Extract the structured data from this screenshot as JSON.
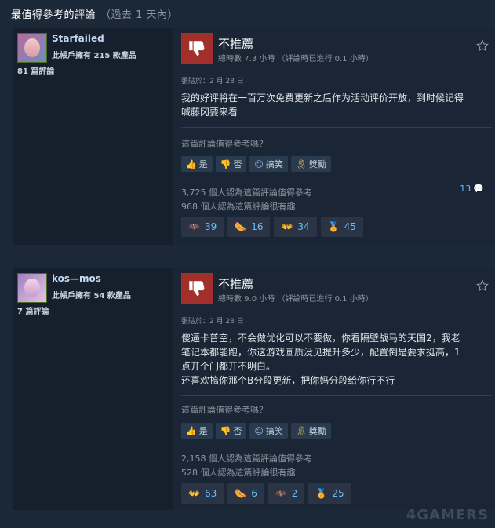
{
  "header": {
    "title": "最值得參考的評論",
    "subtitle": "（過去 1 天內）"
  },
  "reviews": [
    {
      "persona": "Starfailed",
      "products_owned": "此帳戶擁有 215 款產品",
      "review_count": "81 篇評論",
      "verdict": "不推薦",
      "hours": "總時數 7.3 小時 （評論時已進行 0.1 小時）",
      "posted": "張貼於：2 月 28 日",
      "content": [
        "我的好评将在一百万次免费更新之后作为活动评价开放，到时候记得",
        "喊藤冈要来看"
      ],
      "helpful_q": "這篇評論值得參考嗎？",
      "buttons": {
        "yes": "是",
        "no": "否",
        "funny": "搞笑",
        "award": "獎勵"
      },
      "helpful_stat": "3,725 個人認為這篇評論值得參考",
      "funny_stat": "968 個人認為這篇評論很有趣",
      "comment_count": "13",
      "awards": [
        {
          "icon": "bat-wings-icon",
          "count": "39",
          "color": "#e8e8e8"
        },
        {
          "icon": "hotdog-icon",
          "count": "16",
          "color": "#e8922e"
        },
        {
          "icon": "purple-hands-icon",
          "count": "34",
          "color": "#b86ce0"
        },
        {
          "icon": "medal-icon",
          "count": "45",
          "color": "#66c0f4"
        }
      ]
    },
    {
      "persona": "kos—mos",
      "products_owned": "此帳戶擁有 54 款產品",
      "review_count": "7 篇評論",
      "verdict": "不推薦",
      "hours": "總時數 9.0 小時 （評論時已進行 0.1 小時）",
      "posted": "張貼於：2 月 28 日",
      "content": [
        "傻逼卡普空，不会做优化可以不要做，你看隔壁战马的天国2，我老",
        "笔记本都能跑，你这游戏画质没见提升多少，配置倒是要求挺高，1",
        "点开个门都开不明白。",
        "还喜欢搞你那个B分段更新，把你妈分段给你行不行"
      ],
      "helpful_q": "這篇評論值得參考嗎？",
      "buttons": {
        "yes": "是",
        "no": "否",
        "funny": "搞笑",
        "award": "獎勵"
      },
      "helpful_stat": "2,158 個人認為這篇評論值得參考",
      "funny_stat": "528 個人認為這篇評論很有趣",
      "awards": [
        {
          "icon": "purple-hands-icon",
          "count": "63",
          "color": "#b86ce0"
        },
        {
          "icon": "hotdog-icon",
          "count": "6",
          "color": "#e8922e"
        },
        {
          "icon": "bat-wings-icon",
          "count": "2",
          "color": "#e8e8e8"
        },
        {
          "icon": "medal-icon",
          "count": "25",
          "color": "#66c0f4"
        }
      ]
    }
  ],
  "watermark": "4GAMERS"
}
